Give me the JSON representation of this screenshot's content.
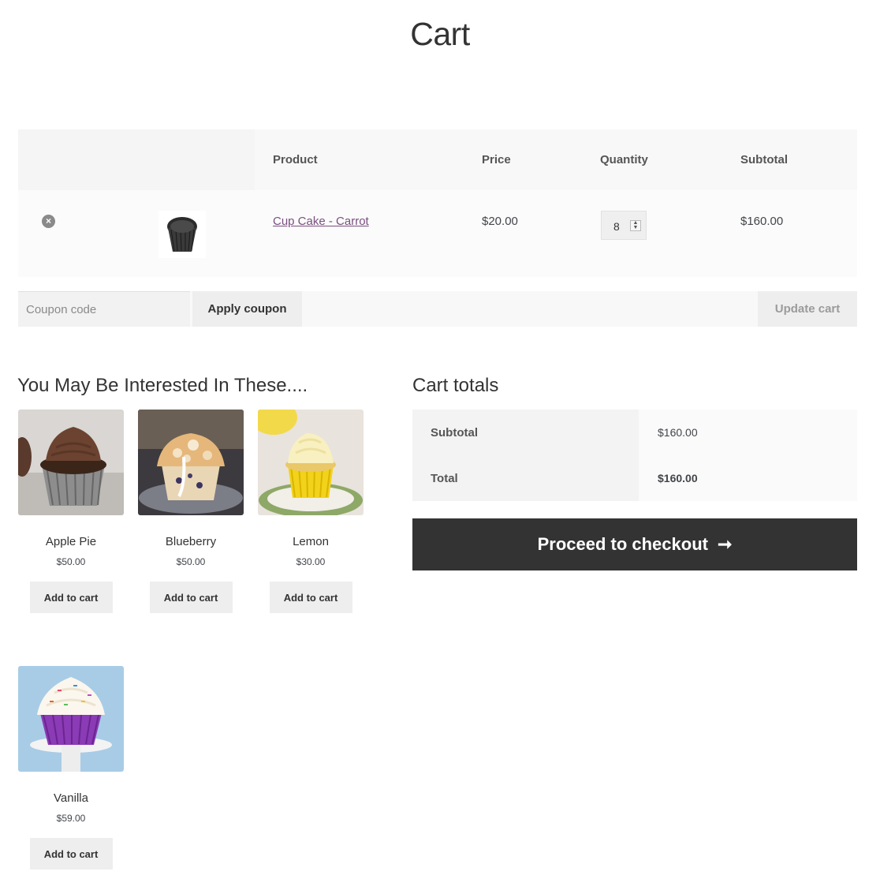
{
  "page": {
    "title": "Cart"
  },
  "cart": {
    "headers": {
      "product": "Product",
      "price": "Price",
      "quantity": "Quantity",
      "subtotal": "Subtotal"
    },
    "items": [
      {
        "name": "Cup Cake - Carrot",
        "price": "$20.00",
        "quantity": "8",
        "subtotal": "$160.00",
        "remove_icon": "remove-x-circle-icon"
      }
    ],
    "coupon_placeholder": "Coupon code",
    "apply_coupon_label": "Apply coupon",
    "update_cart_label": "Update cart"
  },
  "cross_sells": {
    "title": "You May Be Interested In These....",
    "products": [
      {
        "name": "Apple Pie",
        "price": "$50.00",
        "button": "Add to cart"
      },
      {
        "name": "Blueberry",
        "price": "$50.00",
        "button": "Add to cart"
      },
      {
        "name": "Lemon",
        "price": "$30.00",
        "button": "Add to cart"
      },
      {
        "name": "Vanilla",
        "price": "$59.00",
        "button": "Add to cart"
      }
    ]
  },
  "totals": {
    "title": "Cart totals",
    "subtotal_label": "Subtotal",
    "subtotal_value": "$160.00",
    "total_label": "Total",
    "total_value": "$160.00",
    "checkout_label": "Proceed to checkout",
    "checkout_icon": "arrow-right-icon"
  },
  "colors": {
    "link": "#7a4f7f",
    "checkout_bg": "#333333",
    "button_bg": "#eeeeee"
  }
}
